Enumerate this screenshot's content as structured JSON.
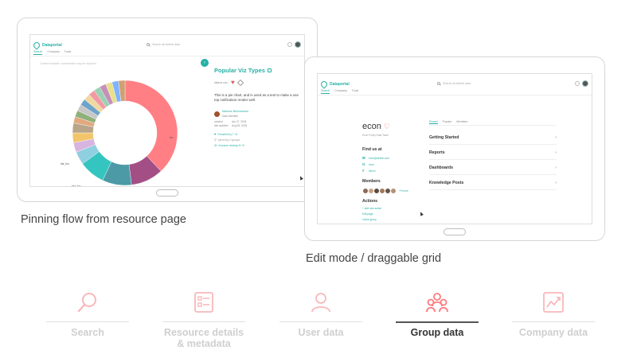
{
  "colors": {
    "accent": "#26b0a6",
    "pink": "#ff7a7f",
    "pink_light": "#f8b8ba",
    "heart": "#e05a5a"
  },
  "app": {
    "brand": "Dataportal",
    "search_placeholder": "Search all Airbnb data",
    "nav": [
      "Search",
      "Company",
      "Tools"
    ]
  },
  "resource_screen": {
    "hint": "Content invisible, confirmation may be required",
    "toggle_glyph": "›",
    "title": "Popular Viz Types",
    "owner": "dataviz.com",
    "description": "This is a pie chart, and is used as a test to make a use top notification render well.",
    "author": "Maurice Benchmann",
    "author_role": "Data Scientist",
    "created_label": "created",
    "created_value": "Apr 27, 2018",
    "updated_label": "last updated",
    "updated_value": "Aug 08, 2018",
    "links": [
      "Favorited by 7 +5",
      "pinned by 0 groups",
      "resource viewing % +5"
    ],
    "donut_labels": [
      "foo",
      "bar_foo",
      "baz_foo"
    ]
  },
  "group_screen": {
    "name": "econ",
    "subtitle": "Econ Policy Data Team",
    "find_us_head": "Find us at",
    "contacts": [
      {
        "icon": "✉",
        "icon_name": "email-icon",
        "text": "econ@airbnb.com"
      },
      {
        "icon": "G",
        "icon_name": "google-icon",
        "text": "econ"
      },
      {
        "icon": "#",
        "icon_name": "slack-icon",
        "text": "#econ"
      }
    ],
    "members_head": "Members",
    "members_more": "+9 more",
    "actions_head": "Actions",
    "actions": [
      "+ add new action",
      "Edit page",
      "Leave group"
    ],
    "tabs": [
      "Pinned",
      "Popular",
      "Members"
    ],
    "categories": [
      "Getting Started",
      "Reports",
      "Dashboards",
      "Knowledge Posts"
    ],
    "chevron": "›"
  },
  "captions": {
    "left": "Pinning flow from resource page",
    "right": "Edit mode / draggable grid"
  },
  "steps": [
    {
      "label": "Search",
      "icon": "search-icon",
      "active": false
    },
    {
      "label": "Resource details & metadata",
      "icon": "document-icon",
      "active": false
    },
    {
      "label": "User data",
      "icon": "user-icon",
      "active": false
    },
    {
      "label": "Group data",
      "icon": "group-icon",
      "active": true
    },
    {
      "label": "Company data",
      "icon": "chart-icon",
      "active": false
    }
  ],
  "donut_data": {
    "type": "pie",
    "values": [
      38,
      10,
      9,
      8,
      4,
      3,
      3,
      3,
      2,
      2,
      2,
      2,
      2,
      2,
      2,
      2,
      2,
      2,
      2
    ],
    "colors": [
      "#ff7f85",
      "#a34f86",
      "#4c9aa6",
      "#35c5c0",
      "#8ecfe0",
      "#d8b4e0",
      "#f2c56b",
      "#b8a58a",
      "#e2a97f",
      "#8fb07a",
      "#c7c7c7",
      "#6fa4c8",
      "#f0d9a0",
      "#f29aa3",
      "#9ad1b4",
      "#c58fb8",
      "#e8e08a",
      "#7fb3ff",
      "#d0a070"
    ]
  }
}
